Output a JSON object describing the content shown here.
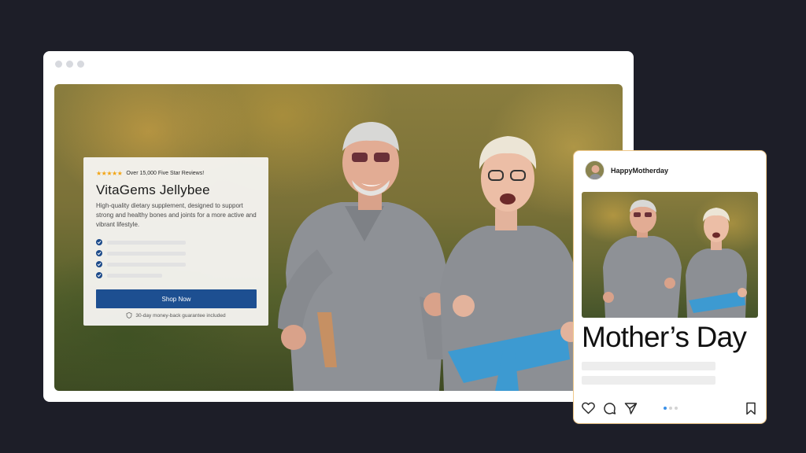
{
  "product": {
    "stars": "★★★★★",
    "review_text": "Over 15,000 Five Star Reviews!",
    "title": "VitaGems Jellybee",
    "description": "High-quality dietary supplement, designed to support strong and healthy bones and joints for a more active and vibrant lifestyle.",
    "features_count": 4,
    "cta_label": "Shop Now",
    "guarantee": "30-day money-back guarantee included"
  },
  "post": {
    "username": "HappyMotherday",
    "headline": "Mother’s Day",
    "carousel": {
      "total": 3,
      "active_index": 0
    },
    "actions": [
      "heart-icon",
      "comment-icon",
      "share-icon",
      "bookmark-icon"
    ]
  },
  "colors": {
    "background": "#1d1e28",
    "cta": "#1d4f91",
    "star": "#f2a516",
    "check": "#1c4a8a",
    "carousel_active": "#3b91e8",
    "post_border": "#f0c98a"
  }
}
